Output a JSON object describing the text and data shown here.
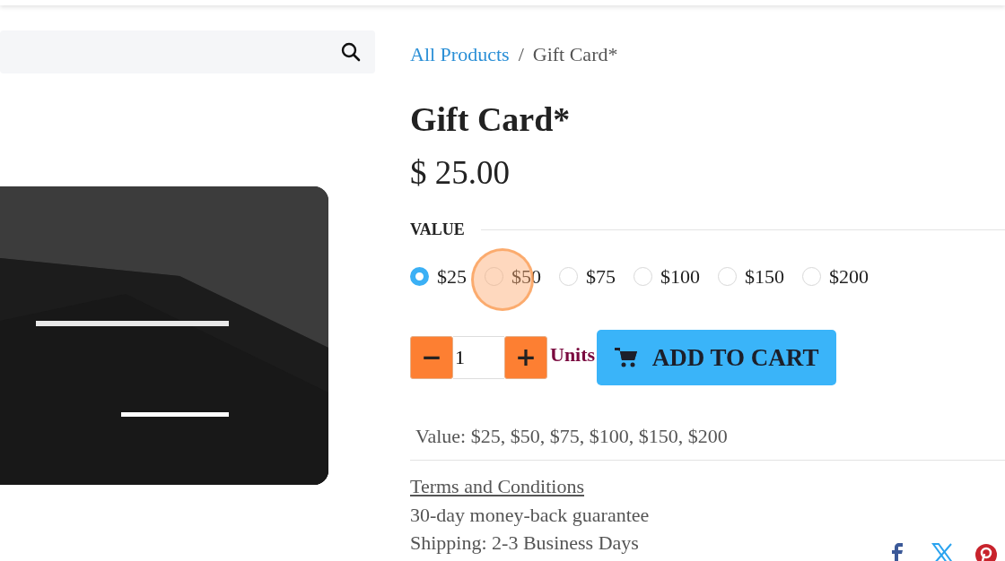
{
  "product_image": {
    "kind": "picture"
  },
  "breadcrumb": [
    {
      "label": "All Products",
      "kind": "link"
    },
    {
      "label": "/",
      "kind": "separator"
    },
    {
      "label": "Gift Card*",
      "kind": "current"
    }
  ],
  "title": "Gift Card*",
  "price": "$ 25.00",
  "attribute": {
    "label": "VALUE",
    "options": [
      {
        "label": "$25",
        "selected": true
      },
      {
        "label": "$50",
        "selected": false
      },
      {
        "label": "$75",
        "selected": false
      },
      {
        "label": "$100",
        "selected": false
      },
      {
        "label": "$150",
        "selected": false
      },
      {
        "label": "$200",
        "selected": false
      }
    ]
  },
  "quantity": {
    "minus": "−",
    "value": "1",
    "plus": "+",
    "unit": "Units"
  },
  "add_to_cart": "ADD TO CART",
  "summary": "Value: $25, $50, $75, $100, $150, $200",
  "terms_link": "Terms and Conditions",
  "notes": [
    "30-day money-back guarantee",
    "Shipping: 2-3 Business Days"
  ],
  "share": [
    {
      "kind": "facebook"
    },
    {
      "kind": "x"
    },
    {
      "kind": "pinterest"
    }
  ]
}
